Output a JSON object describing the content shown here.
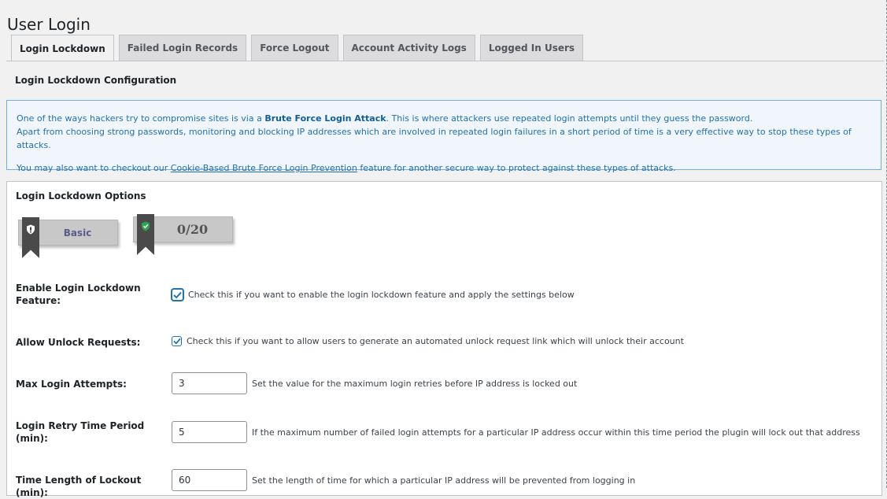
{
  "page": {
    "title": "User Login"
  },
  "tabs": [
    {
      "label": "Login Lockdown",
      "active": true
    },
    {
      "label": "Failed Login Records",
      "active": false
    },
    {
      "label": "Force Logout",
      "active": false
    },
    {
      "label": "Account Activity Logs",
      "active": false
    },
    {
      "label": "Logged In Users",
      "active": false
    }
  ],
  "section": {
    "title": "Login Lockdown Configuration"
  },
  "info": {
    "line1_pre": "One of the ways hackers try to compromise sites is via a ",
    "line1_bold": "Brute Force Login Attack",
    "line1_post": ". This is where attackers use repeated login attempts until they guess the password.",
    "line2": "Apart from choosing strong passwords, monitoring and blocking IP addresses which are involved in repeated login failures in a short period of time is a very effective way to stop these types of attacks.",
    "line3_pre": "You may also want to checkout our ",
    "line3_link": "Cookie-Based Brute Force Login Prevention",
    "line3_post": " feature for another secure way to protect against these types of attacks."
  },
  "options": {
    "title": "Login Lockdown Options",
    "badge_level": "Basic",
    "badge_score": "0/20",
    "enable": {
      "label": "Enable Login Lockdown Feature:",
      "checked": true,
      "description": "Check this if you want to enable the login lockdown feature and apply the settings below"
    },
    "unlock": {
      "label": "Allow Unlock Requests:",
      "checked": true,
      "description": "Check this if you want to allow users to generate an automated unlock request link which will unlock their account"
    },
    "max_attempts": {
      "label": "Max Login Attempts:",
      "value": "3",
      "description": "Set the value for the maximum login retries before IP address is locked out"
    },
    "retry_period": {
      "label": "Login Retry Time Period (min):",
      "value": "5",
      "description": "If the maximum number of failed login attempts for a particular IP address occur within this time period the plugin will lock out that address"
    },
    "lockout_length": {
      "label": "Time Length of Lockout (min):",
      "value": "60",
      "description": "Set the length of time for which a particular IP address will be prevented from logging in"
    }
  },
  "colors": {
    "accent": "#2271b1",
    "info_bg": "#f0f6fc",
    "ribbon": "#4a4a4a",
    "shield_green": "#2ea44f"
  }
}
